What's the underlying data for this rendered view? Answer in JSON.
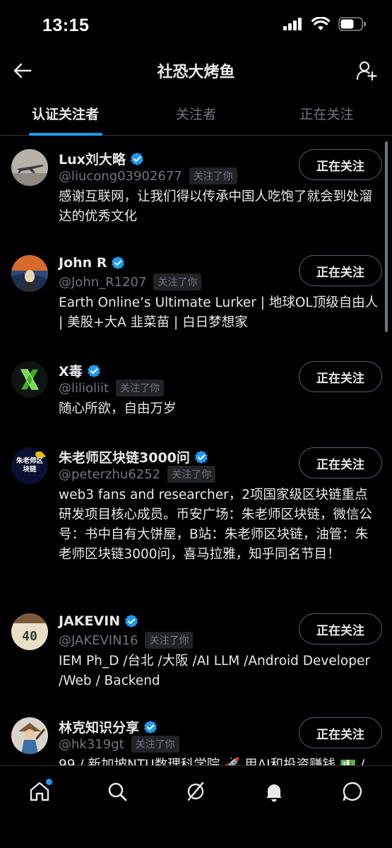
{
  "status_bar": {
    "time": "13:15"
  },
  "header": {
    "title": "社恐大烤鱼"
  },
  "tabs": [
    {
      "label": "认证关注者",
      "active": true
    },
    {
      "label": "关注者",
      "active": false
    },
    {
      "label": "正在关注",
      "active": false
    }
  ],
  "users": [
    {
      "name": "Lux刘大略",
      "handle": "@liucong03902677",
      "follows_you": "关注了你",
      "bio": "感谢互联网，让我们得以传承中国人吃饱了就会到处溜达的优秀文化",
      "button": "正在关注",
      "verified": true
    },
    {
      "name": "John R",
      "handle": "@John_R1207",
      "follows_you": "关注了你",
      "bio": "Earth Online’s Ultimate Lurker | 地球OL顶级自由人 | 美股+大A 韭菜苗 | 白日梦想家",
      "button": "正在关注",
      "verified": true
    },
    {
      "name": "X毒",
      "handle": "@lilioliit",
      "follows_you": "关注了你",
      "bio": "随心所欲，自由万岁",
      "button": "正在关注",
      "verified": true
    },
    {
      "name": "朱老师区块链3000问",
      "handle": "@peterzhu6252",
      "follows_you": "关注了你",
      "bio": "web3 fans and researcher，2项国家级区块链重点研发项目核心成员。币安广场：朱老师区块链，微信公号：书中自有大饼屋，B站：朱老师区块链，油管：朱老师区块链3000问，喜马拉雅，知乎同名节目！",
      "button": "正在关注",
      "verified": true,
      "avatar_text": "朱老师区块链"
    },
    {
      "name": "JAKEVIN",
      "handle": "@JAKEVIN16",
      "follows_you": "关注了你",
      "bio": "IEM Ph_D /台北 /大阪 /AI LLM /Android Developer /Web / Backend",
      "button": "正在关注",
      "verified": true,
      "avatar_text": "40"
    },
    {
      "name": "林克知识分享",
      "handle": "@hk319gt",
      "follows_you": "关注了你",
      "bio": "99 / 新加坡NTU数理科学院 🚀 用AI和投资赚钱 💵 /",
      "button": "正在关注",
      "verified": true
    }
  ],
  "bottom_nav": [
    {
      "icon": "home-icon"
    },
    {
      "icon": "search-icon"
    },
    {
      "icon": "grok-icon"
    },
    {
      "icon": "bell-icon"
    },
    {
      "icon": "message-icon"
    }
  ],
  "colors": {
    "background": "#000000",
    "accent": "#1d9bf0",
    "text_primary": "#e7e9ea",
    "text_secondary": "#71767b"
  }
}
